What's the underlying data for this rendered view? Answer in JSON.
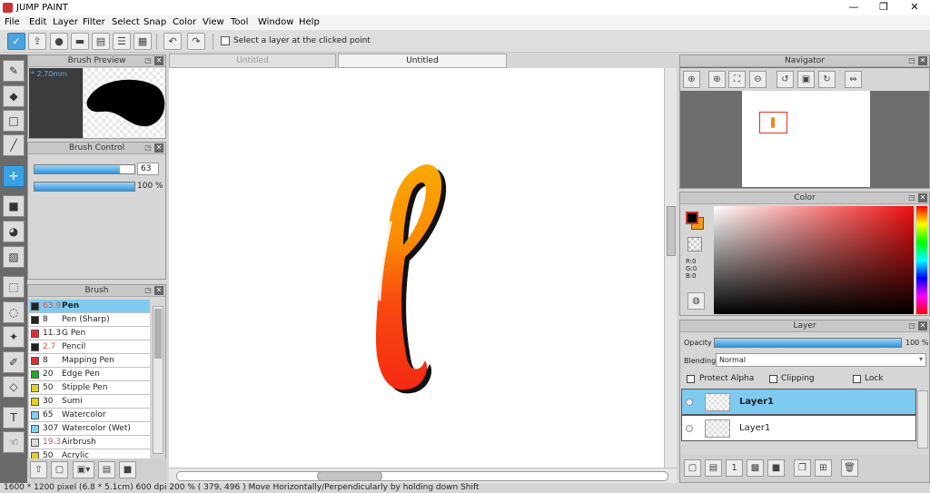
{
  "app": {
    "title": "JUMP PAINT"
  },
  "window": {
    "minimize": "—",
    "maximize": "❐",
    "close": "✕"
  },
  "menu": [
    "File",
    "Edit",
    "Layer",
    "Filter",
    "Select",
    "Snap",
    "Color",
    "View",
    "Tool",
    "Window",
    "Help"
  ],
  "toolbar": {
    "buttons": [
      "pen-mode-icon",
      "export-icon",
      "comment-icon",
      "speech-icon",
      "page-icon",
      "list-icon",
      "grid-icon"
    ],
    "undo_icon": "undo-icon",
    "redo_icon": "redo-icon",
    "select_layer_label": "Select a layer at the clicked point"
  },
  "tools": [
    "pen-tool-icon",
    "eraser-icon",
    "rect-icon",
    "line-icon",
    "move-icon",
    "fill-rect-icon",
    "bucket-icon",
    "gradient-icon",
    "rect-select-icon",
    "lasso-icon",
    "magic-wand-icon",
    "select-pen-icon",
    "select-eraser-icon",
    "text-icon",
    "hand-icon"
  ],
  "brush_preview": {
    "title": "Brush Preview",
    "size": "* 2.70mm"
  },
  "brush_control": {
    "title": "Brush Control",
    "size_value": "63",
    "size_fraction": 0.85,
    "opacity_value": "100 %",
    "opacity_fraction": 1.0
  },
  "brush_list": {
    "title": "Brush",
    "items": [
      {
        "size": "63.9",
        "name": "Pen",
        "color": "#222222",
        "size_color": "#d9534f",
        "selected": true
      },
      {
        "size": "8",
        "name": "Pen (Sharp)",
        "color": "#222222",
        "size_color": "#222222",
        "selected": false
      },
      {
        "size": "11.3",
        "name": "G Pen",
        "color": "#e03030",
        "size_color": "#222222",
        "selected": false
      },
      {
        "size": "2.7",
        "name": "Pencil",
        "color": "#222222",
        "size_color": "#d9534f",
        "selected": false
      },
      {
        "size": "8",
        "name": "Mapping Pen",
        "color": "#e03030",
        "size_color": "#222222",
        "selected": false
      },
      {
        "size": "20",
        "name": "Edge Pen",
        "color": "#22aa22",
        "size_color": "#222222",
        "selected": false
      },
      {
        "size": "50",
        "name": "Stipple Pen",
        "color": "#e8d020",
        "size_color": "#222222",
        "selected": false
      },
      {
        "size": "30",
        "name": "Sumi",
        "color": "#e8d020",
        "size_color": "#222222",
        "selected": false
      },
      {
        "size": "65",
        "name": "Watercolor",
        "color": "#80d0f0",
        "size_color": "#222222",
        "selected": false
      },
      {
        "size": "307",
        "name": "Watercolor (Wet)",
        "color": "#80d0f0",
        "size_color": "#222222",
        "selected": false
      },
      {
        "size": "19.3",
        "name": "Airbrush",
        "color": "#dddddd",
        "size_color": "#d9534f",
        "selected": false
      },
      {
        "size": "50",
        "name": "Acrylic",
        "color": "#e8d020",
        "size_color": "#222222",
        "selected": false
      }
    ]
  },
  "brush_footer": [
    "brush-add-icon",
    "new-brush-icon",
    "copy-brush-icon",
    "brush-settings-icon",
    "folder-icon"
  ],
  "tabs": [
    {
      "label": "Untitled",
      "active": false
    },
    {
      "label": "Untitled",
      "active": true
    }
  ],
  "navigator": {
    "title": "Navigator",
    "buttons": [
      "zoom-fit-icon",
      "zoom-in-icon",
      "fit-window-icon",
      "zoom-out-icon",
      "rotate-left-icon",
      "reset-rotation-icon",
      "rotate-right-icon",
      "flip-icon"
    ]
  },
  "color_panel": {
    "title": "Color",
    "r": "R:0",
    "g": "G:0",
    "b": "B:0",
    "primary": "#000000",
    "secondary": "#f39c12"
  },
  "layer_panel": {
    "title": "Layer",
    "opacity_label": "Opacity",
    "opacity_value": "100 %",
    "opacity_fraction": 1.0,
    "blending_label": "Blending",
    "blending_value": "Normal",
    "protect_alpha": "Protect Alpha",
    "clipping": "Clipping",
    "lock": "Lock",
    "layers": [
      {
        "name": "Layer1",
        "selected": true
      },
      {
        "name": "Layer1",
        "selected": false
      }
    ],
    "footer": [
      "new-layer-icon",
      "new-layer-8bit-icon",
      "new-layer-1bit-icon",
      "halftone-layer-icon",
      "folder-icon",
      "copy-layer-icon",
      "merge-layer-icon",
      "delete-layer-icon"
    ]
  },
  "status": "1600 * 1200 pixel   (6.8 * 5.1cm)   600 dpi   200 %   ( 379, 496 )   Move Horizontally/Perpendicularly by holding down Shift",
  "icons": {
    "checkbox": "checkbox-icon",
    "window-button": "panel-float-icon",
    "close": "close-icon"
  }
}
